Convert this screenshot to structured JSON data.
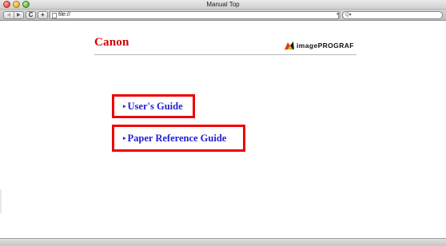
{
  "window": {
    "title": "Manual Top"
  },
  "toolbar": {
    "back_icon": "back-arrow-icon",
    "forward_icon": "forward-arrow-icon",
    "back_glyph": "◀",
    "forward_glyph": "▶",
    "reload_glyph": "C",
    "add_glyph": "+",
    "url": "file://",
    "search_placeholder": "Q▾",
    "url_dropdown_glyph": "▾"
  },
  "header": {
    "logo": "Canon",
    "product_brand": "imagePROGRAF",
    "logo_color": "#d40000"
  },
  "links": {
    "arrow_glyph": "▸",
    "users_guide": "User's Guide",
    "paper_reference_guide": "Paper Reference Guide",
    "link_color": "#1f1fd1",
    "highlight_color": "#ee0000"
  }
}
